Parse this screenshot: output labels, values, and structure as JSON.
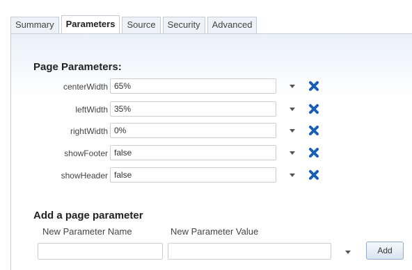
{
  "tabs": [
    {
      "label": "Summary",
      "active": false
    },
    {
      "label": "Parameters",
      "active": true
    },
    {
      "label": "Source",
      "active": false
    },
    {
      "label": "Security",
      "active": false
    },
    {
      "label": "Advanced",
      "active": false
    }
  ],
  "page_parameters": {
    "title": "Page Parameters:",
    "rows": [
      {
        "name": "centerWidth",
        "value": "65%"
      },
      {
        "name": "leftWidth",
        "value": "35%"
      },
      {
        "name": "rightWidth",
        "value": "0%"
      },
      {
        "name": "showFooter",
        "value": "false"
      },
      {
        "name": "showHeader",
        "value": "false"
      }
    ]
  },
  "add_parameter": {
    "title": "Add a page parameter",
    "name_label": "New Parameter Name",
    "value_label": "New Parameter Value",
    "name_value": "",
    "value_value": "",
    "add_label": "Add"
  },
  "colors": {
    "delete_icon": "#1a5fb4",
    "tab_border": "#c4ced8",
    "panel_gradient_top": "#eaf1f9"
  },
  "icons": {
    "row_dropdown": "chevron-down-icon",
    "row_delete": "delete-x-icon"
  }
}
